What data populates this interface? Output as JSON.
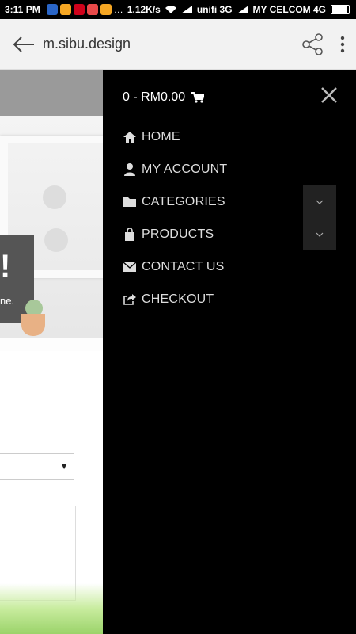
{
  "status_bar": {
    "time": "3:11 PM",
    "speed": "1.12K/s",
    "carrier1": "unifi 3G",
    "carrier2": "MY CELCOM 4G",
    "icon_colors": [
      "#2a66c8",
      "#f5a623",
      "#d0021b",
      "#e84a4a",
      "#f5a623"
    ]
  },
  "browser": {
    "url": "m.sibu.design"
  },
  "site": {
    "promo_exclaim": "!",
    "promo_text": "ne."
  },
  "drawer": {
    "cart_label": "0 - RM0.00",
    "menu": [
      {
        "label": "HOME",
        "icon": "home-icon"
      },
      {
        "label": "MY ACCOUNT",
        "icon": "user-icon"
      },
      {
        "label": "CATEGORIES",
        "icon": "folder-icon",
        "expandable": true
      },
      {
        "label": "PRODUCTS",
        "icon": "shopping-bag-icon",
        "expandable": true
      },
      {
        "label": "CONTACT US",
        "icon": "envelope-icon"
      },
      {
        "label": "CHECKOUT",
        "icon": "share-square-icon"
      }
    ]
  }
}
